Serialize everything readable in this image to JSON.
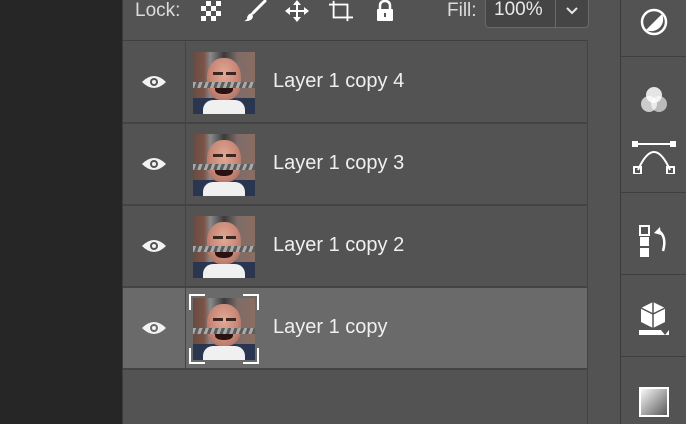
{
  "lock_bar": {
    "lock_label": "Lock:",
    "fill_label": "Fill:",
    "fill_value": "100%"
  },
  "layers": [
    {
      "name": "Layer 1 copy 4",
      "visible": true,
      "selected": false
    },
    {
      "name": "Layer 1 copy 3",
      "visible": true,
      "selected": false
    },
    {
      "name": "Layer 1 copy 2",
      "visible": true,
      "selected": false
    },
    {
      "name": "Layer 1 copy",
      "visible": true,
      "selected": true
    }
  ],
  "right_toolbar": {
    "icons": [
      "adjustments-icon",
      "channels-icon",
      "paths-icon",
      "history-icon",
      "3d-materials-icon",
      "gradient-icon"
    ]
  },
  "colors": {
    "panel": "#535353",
    "selected_row": "#6a6a6a",
    "background": "#262626"
  }
}
